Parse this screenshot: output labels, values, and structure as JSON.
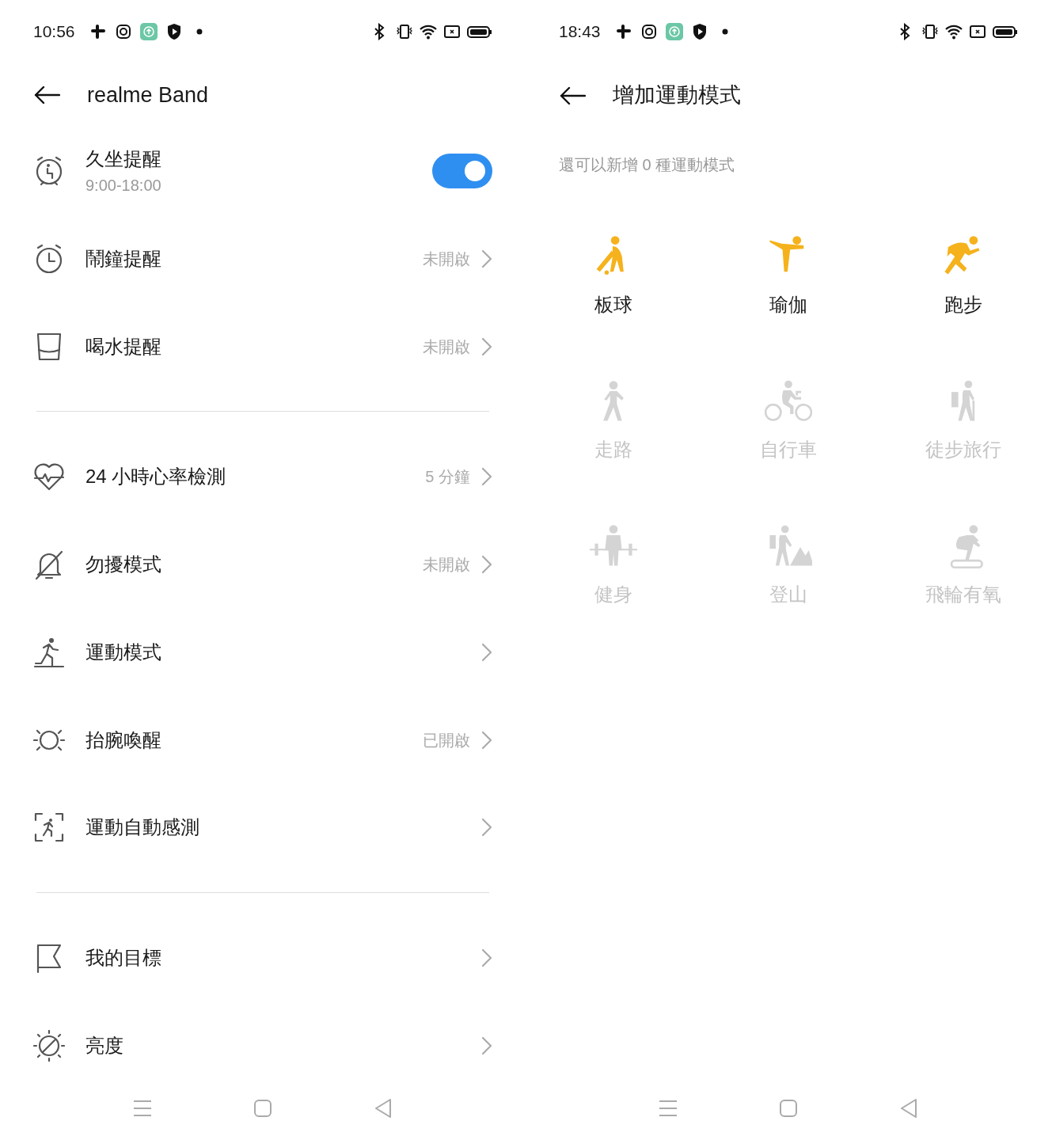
{
  "screens": [
    {
      "status_bar": {
        "time": "10:56"
      },
      "title": "realme Band",
      "groups": [
        [
          {
            "kind": "toggle",
            "label": "久坐提醒",
            "subtitle": "9:00-18:00",
            "on": true
          },
          {
            "kind": "link",
            "label": "鬧鐘提醒",
            "value": "未開啟"
          },
          {
            "kind": "link",
            "label": "喝水提醒",
            "value": "未開啟"
          }
        ],
        [
          {
            "kind": "link",
            "label": "24 小時心率檢測",
            "value": "5 分鐘"
          },
          {
            "kind": "link",
            "label": "勿擾模式",
            "value": "未開啟"
          },
          {
            "kind": "link",
            "label": "運動模式"
          },
          {
            "kind": "link",
            "label": "抬腕喚醒",
            "value": "已開啟"
          },
          {
            "kind": "link",
            "label": "運動自動感測"
          }
        ],
        [
          {
            "kind": "link",
            "label": "我的目標"
          },
          {
            "kind": "link",
            "label": "亮度"
          }
        ]
      ]
    },
    {
      "status_bar": {
        "time": "18:43"
      },
      "title": "增加運動模式",
      "note": "還可以新增 0 種運動模式",
      "sports": [
        {
          "label": "板球",
          "disabled": false
        },
        {
          "label": "瑜伽",
          "disabled": false
        },
        {
          "label": "跑步",
          "disabled": false
        },
        {
          "label": "走路",
          "disabled": true
        },
        {
          "label": "自行車",
          "disabled": true
        },
        {
          "label": "徒步旅行",
          "disabled": true
        },
        {
          "label": "健身",
          "disabled": true
        },
        {
          "label": "登山",
          "disabled": true
        },
        {
          "label": "飛輪有氧",
          "disabled": true
        }
      ]
    }
  ]
}
